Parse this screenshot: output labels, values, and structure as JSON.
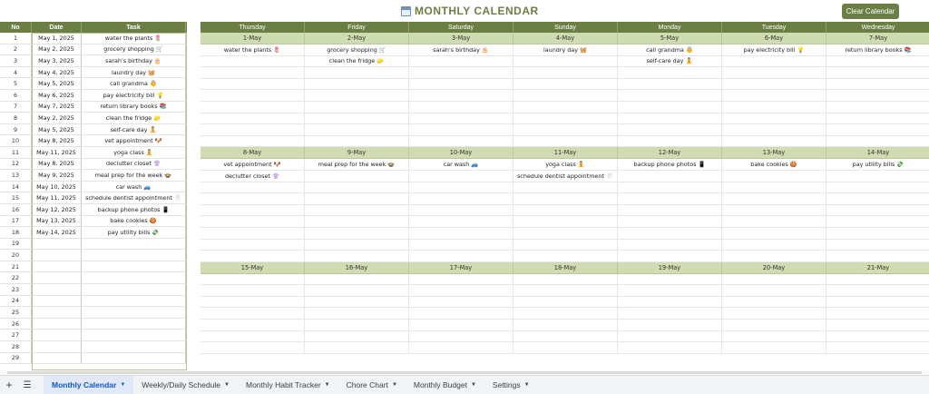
{
  "title": "MONTHLY CALENDAR",
  "title_icon": "calendar-icon",
  "clear_button": "Clear Calendar",
  "left_table": {
    "headers": [
      "No",
      "Date",
      "Task"
    ],
    "rows": [
      {
        "no": "1",
        "date": "May 1, 2025",
        "task": "water the plants 🌷"
      },
      {
        "no": "2",
        "date": "May 2, 2025",
        "task": "grocery shopping 🛒"
      },
      {
        "no": "3",
        "date": "May 3, 2025",
        "task": "sarah's birthday 🎂"
      },
      {
        "no": "4",
        "date": "May 4, 2025",
        "task": "laundry day 🧺"
      },
      {
        "no": "5",
        "date": "May 5, 2025",
        "task": "call grandma 👵"
      },
      {
        "no": "6",
        "date": "May 6, 2025",
        "task": "pay electricity bill 💡"
      },
      {
        "no": "7",
        "date": "May 7, 2025",
        "task": "return library books 📚"
      },
      {
        "no": "8",
        "date": "May 2, 2025",
        "task": "clean the fridge 🧽"
      },
      {
        "no": "9",
        "date": "May 5, 2025",
        "task": "self-care day 🧘"
      },
      {
        "no": "10",
        "date": "May 8, 2025",
        "task": "vet appointment 🐶"
      },
      {
        "no": "11",
        "date": "May 11, 2025",
        "task": "yoga class 🧘"
      },
      {
        "no": "12",
        "date": "May 8, 2025",
        "task": "declutter closet 👚"
      },
      {
        "no": "13",
        "date": "May 9, 2025",
        "task": "meal prep for the week 🍲"
      },
      {
        "no": "14",
        "date": "May 10, 2025",
        "task": "car wash 🚙"
      },
      {
        "no": "15",
        "date": "May 11, 2025",
        "task": "schedule dentist appointment 🦷"
      },
      {
        "no": "16",
        "date": "May 12, 2025",
        "task": "backup phone photos 📱"
      },
      {
        "no": "17",
        "date": "May 13, 2025",
        "task": "bake cookies 🍪"
      },
      {
        "no": "18",
        "date": "May 14, 2025",
        "task": "pay utility bills 💸"
      },
      {
        "no": "19",
        "date": "",
        "task": ""
      },
      {
        "no": "20",
        "date": "",
        "task": ""
      },
      {
        "no": "21",
        "date": "",
        "task": ""
      },
      {
        "no": "22",
        "date": "",
        "task": ""
      },
      {
        "no": "23",
        "date": "",
        "task": ""
      },
      {
        "no": "24",
        "date": "",
        "task": ""
      },
      {
        "no": "25",
        "date": "",
        "task": ""
      },
      {
        "no": "26",
        "date": "",
        "task": ""
      },
      {
        "no": "27",
        "date": "",
        "task": ""
      },
      {
        "no": "28",
        "date": "",
        "task": ""
      },
      {
        "no": "29",
        "date": "",
        "task": ""
      }
    ]
  },
  "calendar": {
    "days": [
      "Thursday",
      "Friday",
      "Saturday",
      "Sunday",
      "Monday",
      "Tuesday",
      "Wednesday"
    ],
    "weeks": [
      {
        "dates": [
          "1-May",
          "2-May",
          "3-May",
          "4-May",
          "5-May",
          "6-May",
          "7-May"
        ],
        "events": [
          [
            "water the plants 🌷",
            "grocery shopping 🛒",
            "sarah's birthday 🎂",
            "laundry day 🧺",
            "call grandma 👵",
            "pay electricity bill 💡",
            "return library books 📚"
          ],
          [
            "",
            "clean the fridge 🧽",
            "",
            "",
            "self-care day 🧘",
            "",
            ""
          ],
          [
            "",
            "",
            "",
            "",
            "",
            "",
            ""
          ],
          [
            "",
            "",
            "",
            "",
            "",
            "",
            ""
          ],
          [
            "",
            "",
            "",
            "",
            "",
            "",
            ""
          ],
          [
            "",
            "",
            "",
            "",
            "",
            "",
            ""
          ],
          [
            "",
            "",
            "",
            "",
            "",
            "",
            ""
          ],
          [
            "",
            "",
            "",
            "",
            "",
            "",
            ""
          ],
          [
            "",
            "",
            "",
            "",
            "",
            "",
            ""
          ]
        ]
      },
      {
        "dates": [
          "8-May",
          "9-May",
          "10-May",
          "11-May",
          "12-May",
          "13-May",
          "14-May"
        ],
        "events": [
          [
            "vet appointment 🐶",
            "meal prep for the week 🍲",
            "car wash 🚙",
            "yoga class 🧘",
            "backup phone photos 📱",
            "bake cookies 🍪",
            "pay utility bills 💸"
          ],
          [
            "declutter closet 👚",
            "",
            "",
            "schedule dentist appointment 🦷",
            "",
            "",
            ""
          ],
          [
            "",
            "",
            "",
            "",
            "",
            "",
            ""
          ],
          [
            "",
            "",
            "",
            "",
            "",
            "",
            ""
          ],
          [
            "",
            "",
            "",
            "",
            "",
            "",
            ""
          ],
          [
            "",
            "",
            "",
            "",
            "",
            "",
            ""
          ],
          [
            "",
            "",
            "",
            "",
            "",
            "",
            ""
          ],
          [
            "",
            "",
            "",
            "",
            "",
            "",
            ""
          ],
          [
            "",
            "",
            "",
            "",
            "",
            "",
            ""
          ]
        ]
      },
      {
        "dates": [
          "15-May",
          "16-May",
          "17-May",
          "18-May",
          "19-May",
          "20-May",
          "21-May"
        ],
        "events": [
          [
            "",
            "",
            "",
            "",
            "",
            "",
            ""
          ],
          [
            "",
            "",
            "",
            "",
            "",
            "",
            ""
          ],
          [
            "",
            "",
            "",
            "",
            "",
            "",
            ""
          ],
          [
            "",
            "",
            "",
            "",
            "",
            "",
            ""
          ],
          [
            "",
            "",
            "",
            "",
            "",
            "",
            ""
          ],
          [
            "",
            "",
            "",
            "",
            "",
            "",
            ""
          ],
          [
            "",
            "",
            "",
            "",
            "",
            "",
            ""
          ]
        ]
      }
    ]
  },
  "tabs": [
    {
      "label": "Monthly Calendar",
      "active": true
    },
    {
      "label": "Weekly/Daily Schedule",
      "active": false
    },
    {
      "label": "Monthly Habit Tracker",
      "active": false
    },
    {
      "label": "Chore Chart",
      "active": false
    },
    {
      "label": "Monthly Budget",
      "active": false
    },
    {
      "label": "Settings",
      "active": false
    }
  ],
  "colors": {
    "accent": "#6b7f44",
    "date_row": "#cfdbb0",
    "active_tab": "#0b57d0"
  }
}
